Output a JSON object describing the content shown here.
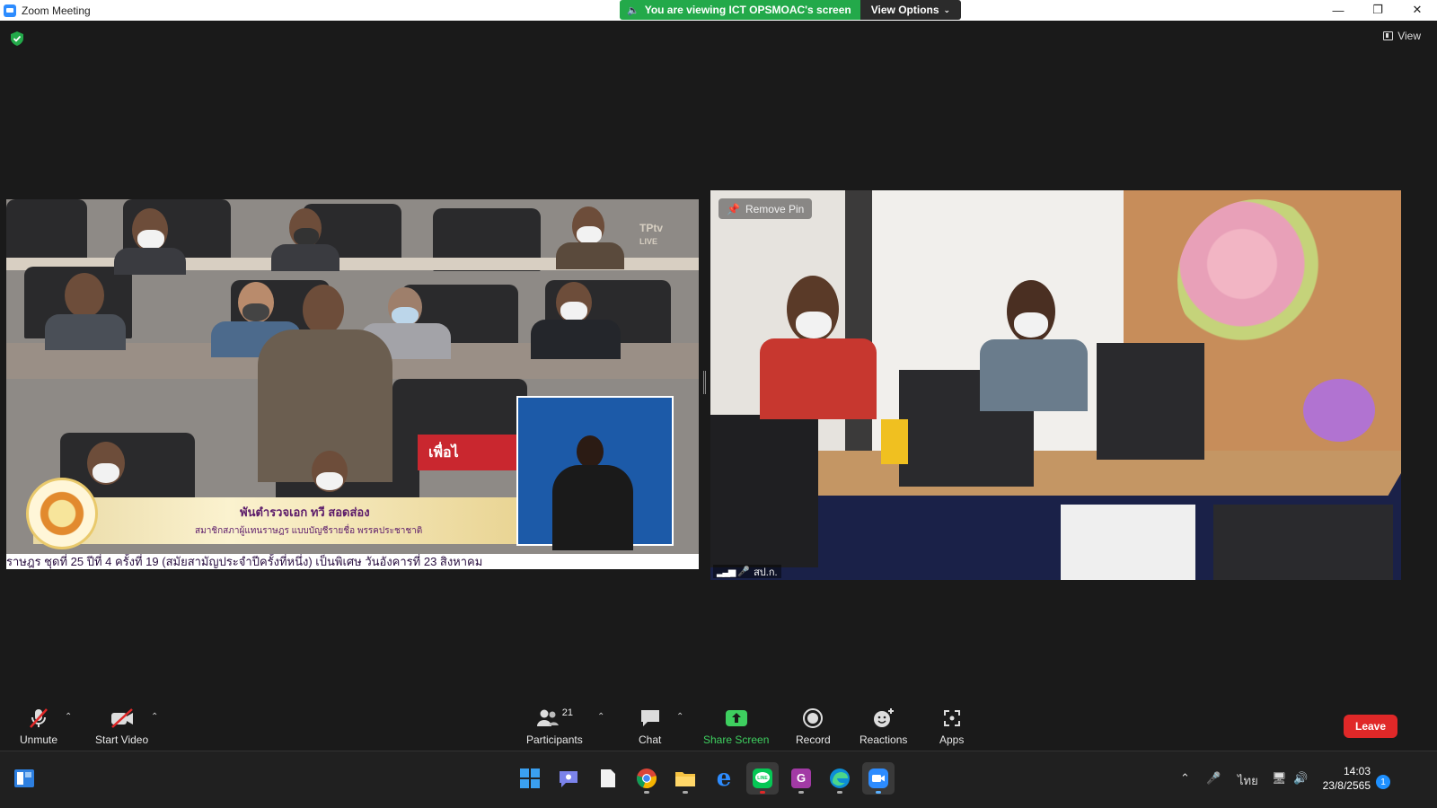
{
  "window": {
    "title": "Zoom Meeting",
    "controls": [
      "minimize",
      "restore",
      "close"
    ]
  },
  "banner": {
    "viewing_text": "You are viewing ICT OPSMOAC's screen",
    "view_options_label": "View Options"
  },
  "meeting": {
    "view_label": "View",
    "shared_screen": {
      "speaker_name": "พันตำรวจเอก ทวี สอดส่อง",
      "speaker_title": "สมาชิกสภาผู้แทนราษฎร แบบบัญชีรายชื่อ พรรคประชาชาติ",
      "ticker": "ราษฎร ชุดที่ 25 ปีที่ 4 ครั้งที่ 19 (สมัยสามัญประจำปีครั้งที่หนึ่ง) เป็นพิเศษ วันอังคารที่ 23 สิงหาคม",
      "channel_logo": "TPtv",
      "channel_live": "LIVE",
      "sign_text": "เพื่อไ"
    },
    "pinned_video": {
      "remove_pin_label": "Remove Pin",
      "participant_name": "สป.ก."
    }
  },
  "toolbar": {
    "unmute_label": "Unmute",
    "start_video_label": "Start Video",
    "participants_label": "Participants",
    "participants_count": "21",
    "chat_label": "Chat",
    "share_screen_label": "Share Screen",
    "record_label": "Record",
    "reactions_label": "Reactions",
    "apps_label": "Apps",
    "leave_label": "Leave"
  },
  "taskbar": {
    "apps": [
      "start",
      "search",
      "teams-chat",
      "notepad",
      "chrome",
      "file-explorer",
      "internet-explorer",
      "line",
      "pdf-editor",
      "edge",
      "zoom"
    ],
    "language": "ไทย",
    "time": "14:03",
    "date": "23/8/2565",
    "notification_count": "1"
  },
  "colors": {
    "banner_green": "#23a94a",
    "zoom_blue": "#2d8cff",
    "leave_red": "#e02828",
    "share_green": "#3ecf5f"
  }
}
